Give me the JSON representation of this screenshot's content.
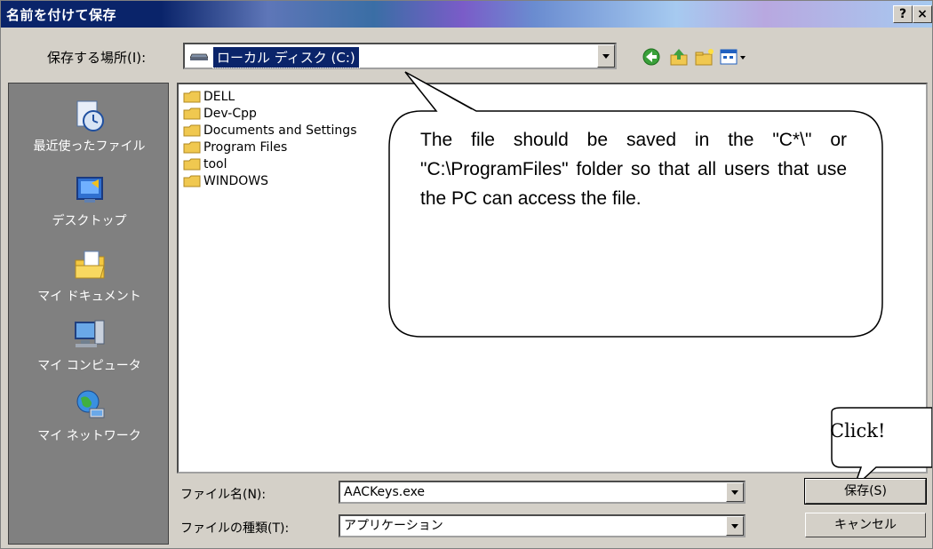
{
  "window": {
    "title": "名前を付けて保存",
    "help_button": "?",
    "close_button": "×"
  },
  "toolbar": {
    "save_in_label": "保存する場所(I):",
    "save_in_value": "ローカル ディスク (C:)",
    "back_icon": "back-arrow",
    "up_icon": "up-folder",
    "new_folder_icon": "new-folder",
    "view_icon": "view-menu"
  },
  "places": [
    {
      "label": "最近使ったファイル",
      "icon": "recent-icon"
    },
    {
      "label": "デスクトップ",
      "icon": "desktop-icon"
    },
    {
      "label": "マイ ドキュメント",
      "icon": "documents-icon"
    },
    {
      "label": "マイ コンピュータ",
      "icon": "computer-icon"
    },
    {
      "label": "マイ ネットワーク",
      "icon": "network-icon"
    }
  ],
  "folders": [
    "DELL",
    "Dev-Cpp",
    "Documents and Settings",
    "Program Files",
    "tool",
    "WINDOWS"
  ],
  "callout": {
    "text": "The file should be saved in the \"C*\\\" or \"C:\\ProgramFiles\" folder so that all users that use the PC can access the file."
  },
  "click_bubble": {
    "text": "Click!"
  },
  "filename": {
    "label": "ファイル名(N):",
    "value": "AACKeys.exe"
  },
  "filetype": {
    "label": "ファイルの種類(T):",
    "value": "アプリケーション"
  },
  "buttons": {
    "save": "保存(S)",
    "cancel": "キャンセル"
  },
  "colors": {
    "titlebar": "#0a246a",
    "dialog": "#d4d0c8",
    "places_bar": "#808080",
    "selection": "#0a246a",
    "folder": "#f0c850"
  }
}
